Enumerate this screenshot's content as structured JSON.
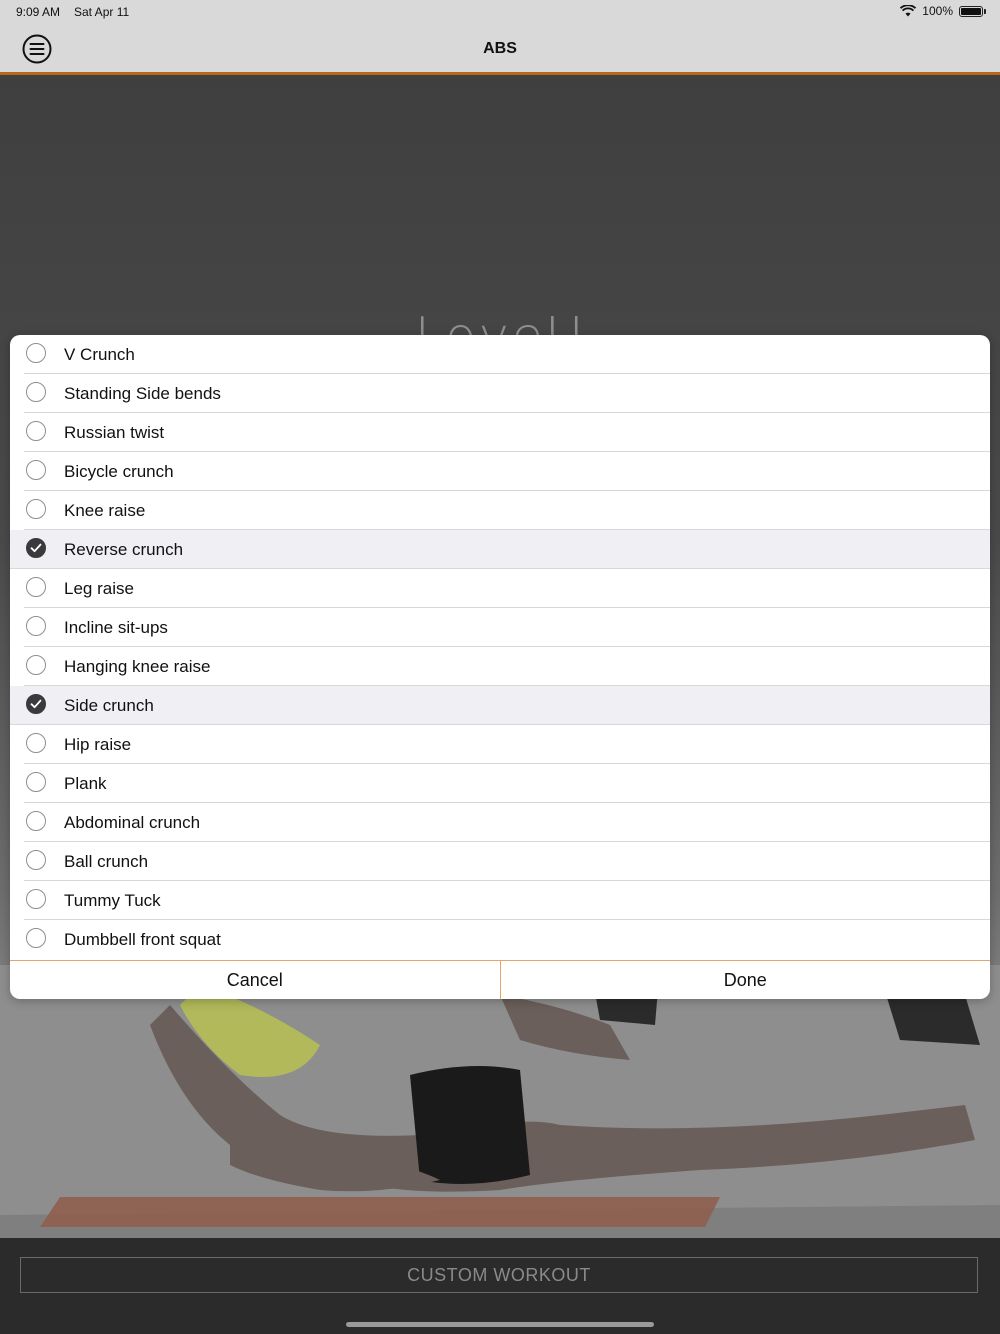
{
  "status_bar": {
    "time": "9:09 AM",
    "date": "Sat Apr 11",
    "battery": "100%"
  },
  "nav": {
    "title": "ABS"
  },
  "hero": {
    "logo_text": "LoveU"
  },
  "bottom": {
    "custom_workout_label": "CUSTOM WORKOUT"
  },
  "picker": {
    "items": [
      {
        "label": "V Crunch",
        "checked": false
      },
      {
        "label": "Standing Side bends",
        "checked": false
      },
      {
        "label": "Russian twist",
        "checked": false
      },
      {
        "label": "Bicycle crunch",
        "checked": false
      },
      {
        "label": "Knee raise",
        "checked": false
      },
      {
        "label": "Reverse crunch",
        "checked": true
      },
      {
        "label": "Leg raise",
        "checked": false
      },
      {
        "label": "Incline sit-ups",
        "checked": false
      },
      {
        "label": "Hanging knee raise",
        "checked": false
      },
      {
        "label": "Side crunch",
        "checked": true
      },
      {
        "label": "Hip raise",
        "checked": false
      },
      {
        "label": "Plank",
        "checked": false
      },
      {
        "label": "Abdominal crunch",
        "checked": false
      },
      {
        "label": "Ball crunch",
        "checked": false
      },
      {
        "label": "Tummy Tuck",
        "checked": false
      },
      {
        "label": "Dumbbell front squat",
        "checked": false
      }
    ],
    "cancel_label": "Cancel",
    "done_label": "Done"
  },
  "colors": {
    "accent": "#b8651e",
    "divider_accent": "#e8a46a",
    "selected_row": "#efeff4"
  }
}
